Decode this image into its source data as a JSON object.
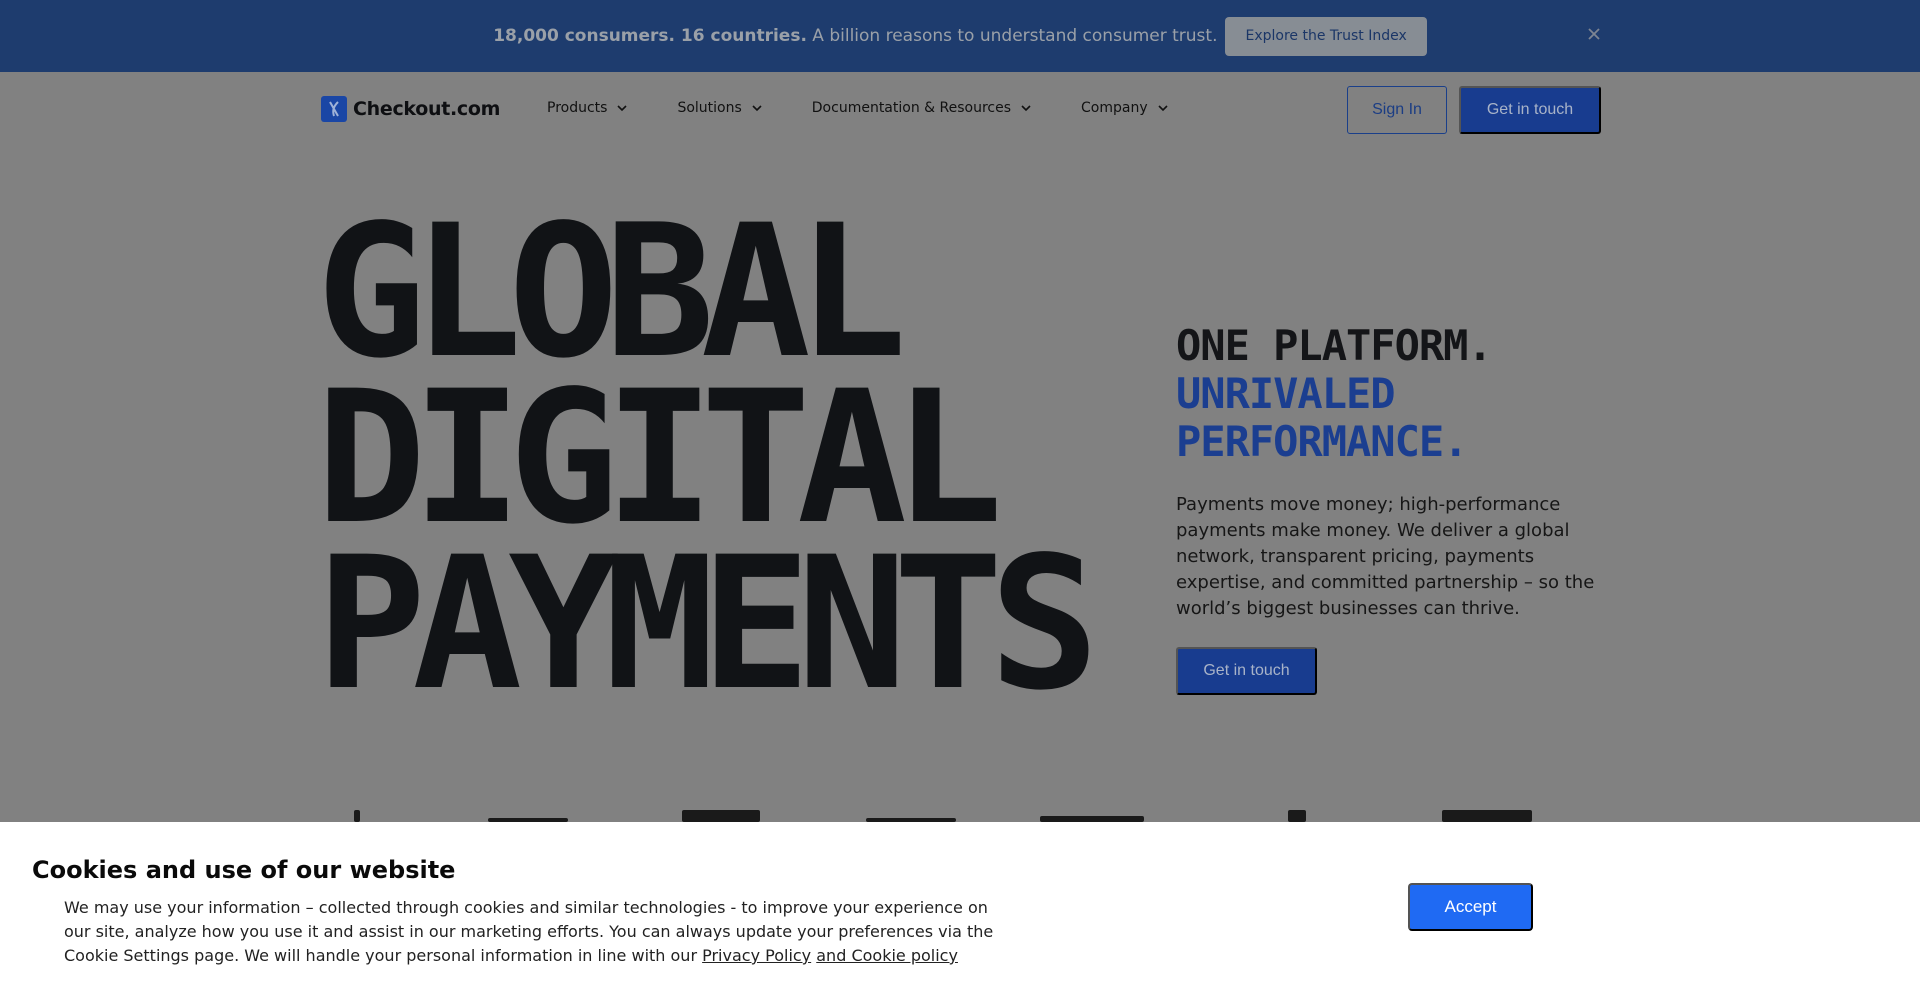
{
  "banner": {
    "bold_text": "18,000 consumers. 16 countries.",
    "text": " A billion reasons to understand consumer trust.",
    "button_label": "Explore the Trust Index",
    "close_icon": "close-icon"
  },
  "nav": {
    "logo_text": "Checkout.com",
    "items": [
      {
        "label": "Products"
      },
      {
        "label": "Solutions"
      },
      {
        "label": "Documentation & Resources"
      },
      {
        "label": "Company"
      }
    ],
    "sign_in_label": "Sign In",
    "get_in_touch_label": "Get in touch"
  },
  "hero": {
    "title_lines": [
      "GLOBAL",
      "DIGITAL",
      "PAYMENTS"
    ],
    "tagline_line1": "ONE PLATFORM.",
    "tagline_line2": "UNRIVALED",
    "tagline_line3": "PERFORMANCE.",
    "description": "Payments move money; high-performance payments make money. We deliver a global network, transparent pricing, payments expertise, and committed partnership – so the world’s biggest businesses can thrive.",
    "cta_label": "Get in touch"
  },
  "cookie": {
    "title": "Cookies and use of our website",
    "text": "We may use your information – collected through cookies and similar technologies - to improve your experience on our site, analyze how you use it and assist in our marketing efforts. You can always update your preferences via the Cookie Settings page. We will handle your personal information in line with our ",
    "privacy_link": "Privacy Policy",
    "cookie_link": "and Cookie policy",
    "accept_label": "Accept"
  },
  "colors": {
    "banner_bg": "#1e3c6e",
    "primary_blue": "#1b3e90",
    "accept_blue": "#1f6af3",
    "overlay_bg": "#818181"
  }
}
